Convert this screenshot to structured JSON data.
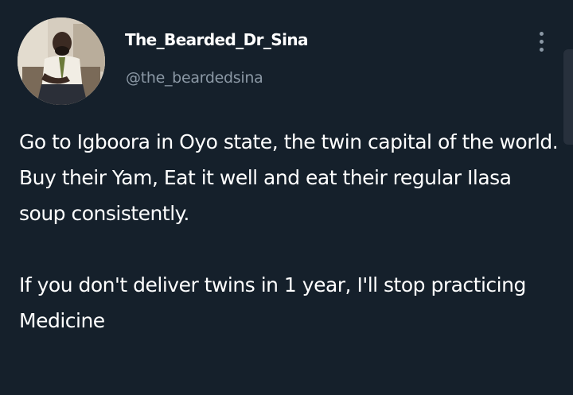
{
  "author": {
    "display_name": "The_Bearded_Dr_Sina",
    "handle": "@the_beardedsina"
  },
  "tweet": {
    "paragraph_1": "Go to Igboora in Oyo state, the twin capital of the world.",
    "paragraph_2": "Buy their Yam, Eat it well and eat their regular Ilasa soup consistently.",
    "paragraph_3": "If you don't deliver twins in 1 year, I'll stop practicing Medicine"
  },
  "icons": {
    "menu": "more-vertical-icon"
  },
  "colors": {
    "background": "#15202b",
    "text_primary": "#ffffff",
    "text_secondary": "#8b98a5"
  }
}
